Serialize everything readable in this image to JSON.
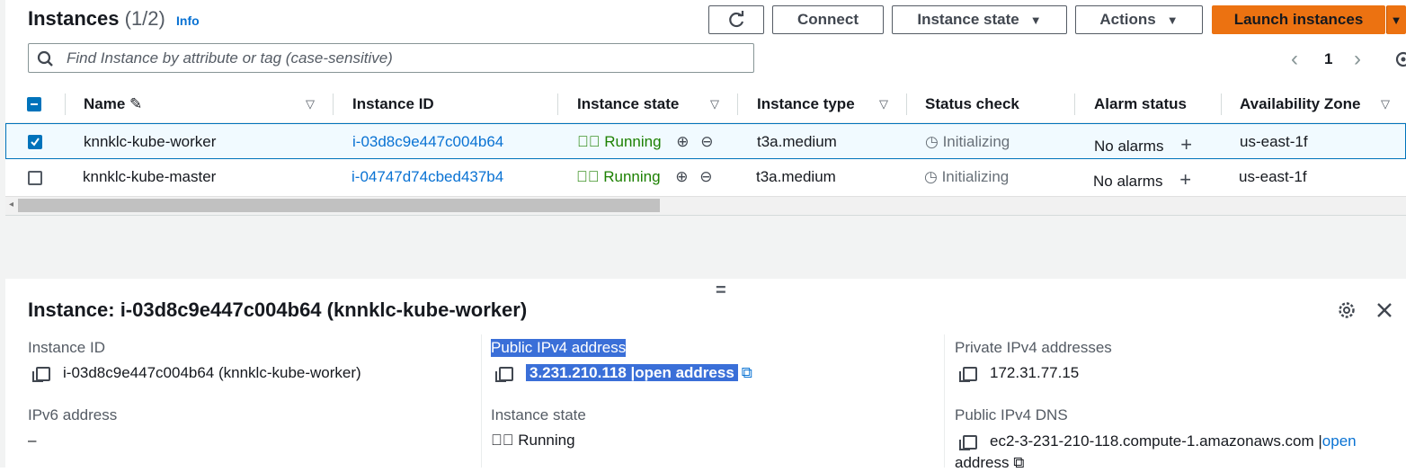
{
  "header": {
    "title": "Instances",
    "count": "(1/2)",
    "info": "Info",
    "refresh_icon": "refresh-icon",
    "connect": "Connect",
    "instance_state": "Instance state",
    "actions": "Actions",
    "launch": "Launch instances"
  },
  "search": {
    "placeholder": "Find Instance by attribute or tag (case-sensitive)"
  },
  "pager": {
    "page": "1"
  },
  "table": {
    "columns": [
      "Name",
      "Instance ID",
      "Instance state",
      "Instance type",
      "Status check",
      "Alarm status",
      "Availability Zone"
    ],
    "rows": [
      {
        "name": "knnklc-kube-worker",
        "id": "i-03d8c9e447c004b64",
        "state": "Running",
        "type": "t3a.medium",
        "status": "Initializing",
        "alarm": "No alarms",
        "az": "us-east-1f",
        "selected": true
      },
      {
        "name": "knnklc-kube-master",
        "id": "i-04747d74cbed437b4",
        "state": "Running",
        "type": "t3a.medium",
        "status": "Initializing",
        "alarm": "No alarms",
        "az": "us-east-1f",
        "selected": false
      }
    ]
  },
  "details": {
    "title": "Instance: i-03d8c9e447c004b64 (knnklc-kube-worker)",
    "instance_id_label": "Instance ID",
    "instance_id_value": "i-03d8c9e447c004b64 (knnklc-kube-worker)",
    "ipv6_label": "IPv6 address",
    "ipv6_value": "–",
    "public_ipv4_label": "Public IPv4 address",
    "public_ipv4_value": "3.231.210.118 |open address",
    "state_label": "Instance state",
    "state_value": "Running",
    "private_ipv4_label": "Private IPv4 addresses",
    "private_ipv4_value": "172.31.77.15",
    "public_dns_label": "Public IPv4 DNS",
    "public_dns_value": "ec2-3-231-210-118.compute-1.amazonaws.com |",
    "open_label": "open",
    "address_label": "address"
  },
  "colors": {
    "accent": "#0972d3",
    "launch": "#ec7211",
    "running": "#1d8102",
    "selection": "#3a6fd8"
  }
}
